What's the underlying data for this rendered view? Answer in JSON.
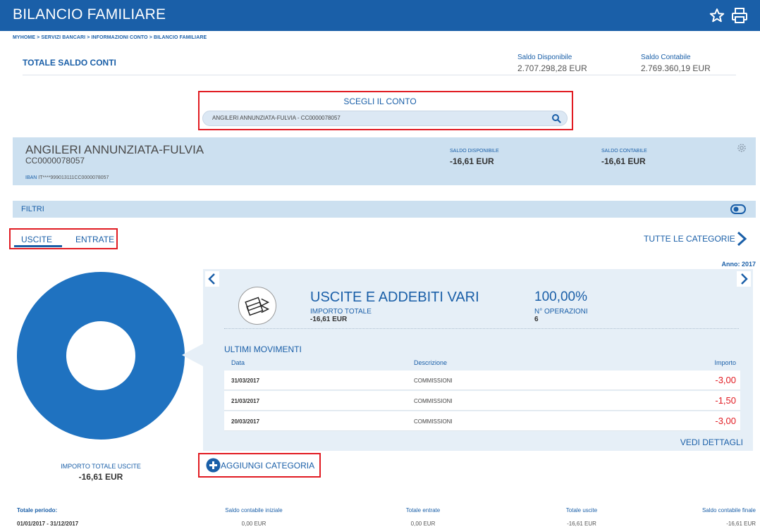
{
  "header": {
    "title": "BILANCIO FAMILIARE",
    "icons": [
      "star-icon",
      "print-icon"
    ]
  },
  "breadcrumb": "MYHOME > SERVIZI BANCARI > INFORMAZIONI CONTO > BILANCIO FAMILIARE",
  "totale_saldo": {
    "title": "TOTALE SALDO CONTI",
    "disponibile_label": "Saldo Disponibile",
    "disponibile_value": "2.707.298,28 EUR",
    "contabile_label": "Saldo Contabile",
    "contabile_value": "2.769.360,19 EUR"
  },
  "scegli_conto": {
    "label": "SCEGLI IL CONTO",
    "value": "ANGILERI ANNUNZIATA-FULVIA - CC0000078057"
  },
  "account": {
    "name": "ANGILERI ANNUNZIATA-FULVIA",
    "code": "CC0000078057",
    "iban_label": "IBAN",
    "iban_value": "IT****999013111CC0000078057",
    "disponibile_label": "SALDO DISPONIBILE",
    "disponibile_value": "-16,61 EUR",
    "contabile_label": "SALDO CONTABILE",
    "contabile_value": "-16,61 EUR"
  },
  "filtri": {
    "label": "FILTRI"
  },
  "tabs": {
    "uscite": "USCITE",
    "entrate": "ENTRATE"
  },
  "tutte_categorie": "TUTTE LE CATEGORIE",
  "anno": "Anno: 2017",
  "donut": {
    "color": "#1f72c0",
    "share": 1.0
  },
  "category": {
    "title": "USCITE E ADDEBITI VARI",
    "importo_label": "IMPORTO TOTALE",
    "importo_value": "-16,61 EUR",
    "percent": "100,00%",
    "operazioni_label": "N° OPERAZIONI",
    "operazioni_value": "6"
  },
  "movimenti": {
    "title": "ULTIMI MOVIMENTI",
    "columns": {
      "data": "Data",
      "descrizione": "Descrizione",
      "importo": "Importo"
    },
    "rows": [
      {
        "data": "31/03/2017",
        "descrizione": "COMMISSIONI",
        "importo": "-3,00"
      },
      {
        "data": "21/03/2017",
        "descrizione": "COMMISSIONI",
        "importo": "-1,50"
      },
      {
        "data": "20/03/2017",
        "descrizione": "COMMISSIONI",
        "importo": "-3,00"
      }
    ],
    "vedi_dettagli": "VEDI DETTAGLI"
  },
  "importo_totale": {
    "label": "IMPORTO TOTALE USCITE",
    "value": "-16,61 EUR"
  },
  "aggiungi_categoria": "AGGIUNGI CATEGORIA",
  "footer": {
    "totale_periodo_label": "Totale periodo:",
    "periodo_value": "01/01/2017 - 31/12/2017",
    "saldo_iniziale_label": "Saldo contabile iniziale",
    "saldo_iniziale_value": "0,00 EUR",
    "entrate_label": "Totale entrate",
    "entrate_value": "0,00 EUR",
    "uscite_label": "Totale uscite",
    "uscite_value": "-16,61 EUR",
    "saldo_finale_label": "Saldo contabile finale",
    "saldo_finale_value": "-16,61 EUR"
  },
  "colors": {
    "brand": "#1a5fa8",
    "light_panel": "#cce0f0",
    "negative": "#e11b22",
    "highlight_box": "#e11b22"
  }
}
